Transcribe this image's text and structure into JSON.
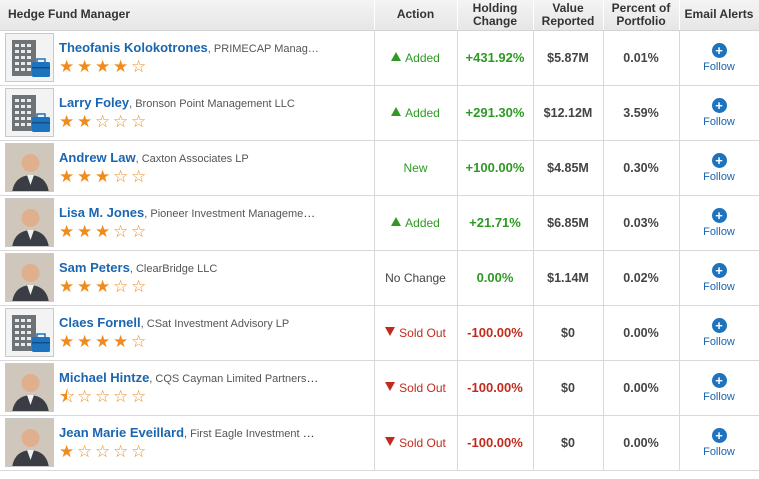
{
  "header": {
    "manager": "Hedge Fund Manager",
    "action": "Action",
    "holding_change": "Holding Change",
    "value_reported": "Value Reported",
    "percent_portfolio": "Percent of Portfolio",
    "email_alerts": "Email Alerts"
  },
  "colors": {
    "link": "#1a66b0",
    "positive": "#2e9a24",
    "negative": "#c12b1e",
    "star": "#f08c1e",
    "follow_button": "#1e73be"
  },
  "rows": [
    {
      "name": "Theofanis Kolokotrones",
      "firm": ", PRIMECAP Manag…",
      "avatar": "building-icon",
      "rating": 4,
      "action": "Added",
      "action_type": "added",
      "change": "+431.92%",
      "value": "$5.87M",
      "percent": "0.01%",
      "follow": "Follow"
    },
    {
      "name": "Larry Foley",
      "firm": ", Bronson Point Management LLC",
      "avatar": "building-icon",
      "rating": 2,
      "action": "Added",
      "action_type": "added",
      "change": "+291.30%",
      "value": "$12.12M",
      "percent": "3.59%",
      "follow": "Follow"
    },
    {
      "name": "Andrew Law",
      "firm": ", Caxton Associates LP",
      "avatar": "person-photo",
      "rating": 3,
      "action": "New",
      "action_type": "new",
      "change": "+100.00%",
      "value": "$4.85M",
      "percent": "0.30%",
      "follow": "Follow"
    },
    {
      "name": "Lisa M. Jones",
      "firm": ", Pioneer Investment Management…",
      "avatar": "person-photo",
      "rating": 3,
      "action": "Added",
      "action_type": "added",
      "change": "+21.71%",
      "value": "$6.85M",
      "percent": "0.03%",
      "follow": "Follow"
    },
    {
      "name": "Sam Peters",
      "firm": ", ClearBridge LLC",
      "avatar": "person-photo",
      "rating": 3,
      "action": "No Change",
      "action_type": "none",
      "change": "0.00%",
      "value": "$1.14M",
      "percent": "0.02%",
      "follow": "Follow"
    },
    {
      "name": "Claes Fornell",
      "firm": ", CSat Investment Advisory LP",
      "avatar": "building-icon",
      "rating": 4,
      "action": "Sold Out",
      "action_type": "sold",
      "change": "-100.00%",
      "value": "$0",
      "percent": "0.00%",
      "follow": "Follow"
    },
    {
      "name": "Michael Hintze",
      "firm": ", CQS Cayman Limited Partnership",
      "avatar": "person-photo",
      "rating": 0.5,
      "action": "Sold Out",
      "action_type": "sold",
      "change": "-100.00%",
      "value": "$0",
      "percent": "0.00%",
      "follow": "Follow"
    },
    {
      "name": "Jean Marie Eveillard",
      "firm": ", First Eagle Investment M…",
      "avatar": "person-photo",
      "rating": 1,
      "action": "Sold Out",
      "action_type": "sold",
      "change": "-100.00%",
      "value": "$0",
      "percent": "0.00%",
      "follow": "Follow"
    }
  ]
}
